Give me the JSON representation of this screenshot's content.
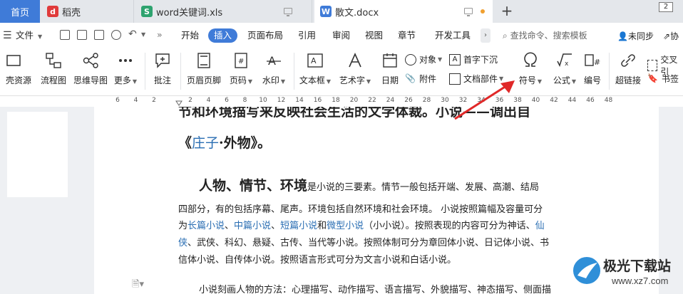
{
  "tabs": {
    "home": "首页",
    "daoke": "稻壳",
    "xls": "word关键词.xls",
    "doc": "散文.docx",
    "add": "+",
    "window_badge": "2"
  },
  "menubar": {
    "file": "文件",
    "items": [
      "开始",
      "插入",
      "页面布局",
      "引用",
      "审阅",
      "视图",
      "章节",
      "开发工具"
    ],
    "search": "查找命令、搜索模板",
    "sync": "未同步",
    "share": "协"
  },
  "ribbon": {
    "big": [
      {
        "key": "resource",
        "label": "稻壳资源",
        "shown": "壳资源"
      },
      {
        "key": "flow",
        "label": "流程图"
      },
      {
        "key": "mind",
        "label": "思维导图"
      },
      {
        "key": "more",
        "label": "更多"
      },
      {
        "key": "comment",
        "label": "批注"
      },
      {
        "key": "header",
        "label": "页眉页脚"
      },
      {
        "key": "pagenum",
        "label": "页码"
      },
      {
        "key": "watermark",
        "label": "水印"
      },
      {
        "key": "textbox",
        "label": "文本框"
      },
      {
        "key": "art",
        "label": "艺术字"
      },
      {
        "key": "date",
        "label": "日期"
      },
      {
        "key": "symbol",
        "label": "符号"
      },
      {
        "key": "formula",
        "label": "公式"
      },
      {
        "key": "number",
        "label": "编号"
      },
      {
        "key": "hyperlink",
        "label": "超链接"
      }
    ],
    "small": {
      "object": "对象",
      "attach": "附件",
      "dropcap": "首字下沉",
      "docpart": "文档部件",
      "crossref": "交叉引",
      "bookmark": "书签"
    }
  },
  "ruler": [
    "6",
    "4",
    "2",
    "",
    "2",
    "4",
    "6",
    "8",
    "10",
    "12",
    "14",
    "16",
    "18",
    "20",
    "22",
    "24",
    "26",
    "28",
    "30",
    "32",
    "34",
    "36",
    "38",
    "40",
    "42",
    "44",
    "46",
    "48"
  ],
  "doc": {
    "line1": "节和环境描写来反映社会生活的文学体裁。小说——调出自",
    "line2a": "《",
    "line2b": "庄子",
    "line2c": "·外物》。",
    "p1_head": "人物、情节、环境",
    "p1_rest": "是小说的三要素。情节一般包括开端、发展、高潮、结局",
    "p1_l2": "四部分，有的包括序幕、尾声。环境包括自然环境和社会环境。 小说按照篇幅及容量可分",
    "p1_l3": [
      "为",
      "长篇小说",
      "、",
      "中篇小说",
      "、",
      "短篇小说",
      "和",
      "微型小说",
      "（小小说）。按照表现的内容可分为神话、",
      "仙"
    ],
    "p1_l4": [
      "侠",
      "、武侠、科幻、悬疑、古传、当代等小说。按照体制可分为章回体小说、日记体小说、书"
    ],
    "p1_l5": "信体小说、自传体小说。按照语言形式可分为文言小说和白话小说。",
    "p2": "小说刻画人物的方法：心理描写、动作描写、语言描写、外貌描写、神态描写、侧面描"
  },
  "watermark": {
    "title": "极光下载站",
    "url": "www.xz7.com"
  },
  "colors": {
    "accent": "#3f7bd8",
    "link": "#2a6eb3",
    "arrow": "#e02828"
  }
}
